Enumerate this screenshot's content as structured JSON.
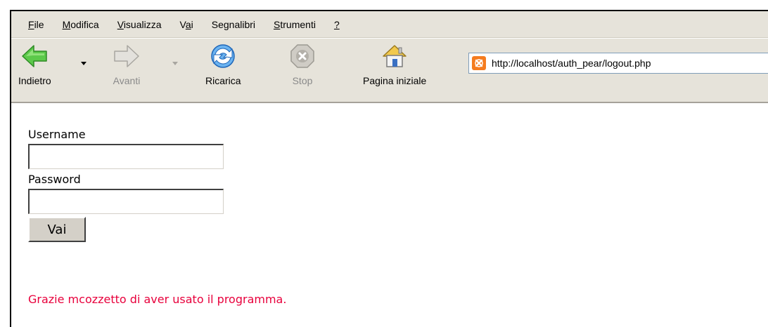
{
  "menubar": {
    "items": [
      {
        "pre": "",
        "key": "F",
        "post": "ile"
      },
      {
        "pre": "",
        "key": "M",
        "post": "odifica"
      },
      {
        "pre": "",
        "key": "V",
        "post": "isualizza"
      },
      {
        "pre": "V",
        "key": "a",
        "post": "i"
      },
      {
        "pre": "Se",
        "key": "g",
        "post": "nalibri"
      },
      {
        "pre": "",
        "key": "S",
        "post": "trumenti"
      },
      {
        "pre": "",
        "key": "?",
        "post": ""
      }
    ]
  },
  "toolbar": {
    "back_label": "Indietro",
    "forward_label": "Avanti",
    "reload_label": "Ricarica",
    "stop_label": "Stop",
    "home_label": "Pagina iniziale"
  },
  "address_bar": {
    "url": "http://localhost/auth_pear/logout.php",
    "favicon": "xampp-icon"
  },
  "form": {
    "username_label": "Username",
    "username_value": "",
    "password_label": "Password",
    "password_value": "",
    "submit_label": "Vai"
  },
  "message": {
    "text": "Grazie mcozzetto di aver usato il programma.",
    "color": "#e8003c"
  }
}
